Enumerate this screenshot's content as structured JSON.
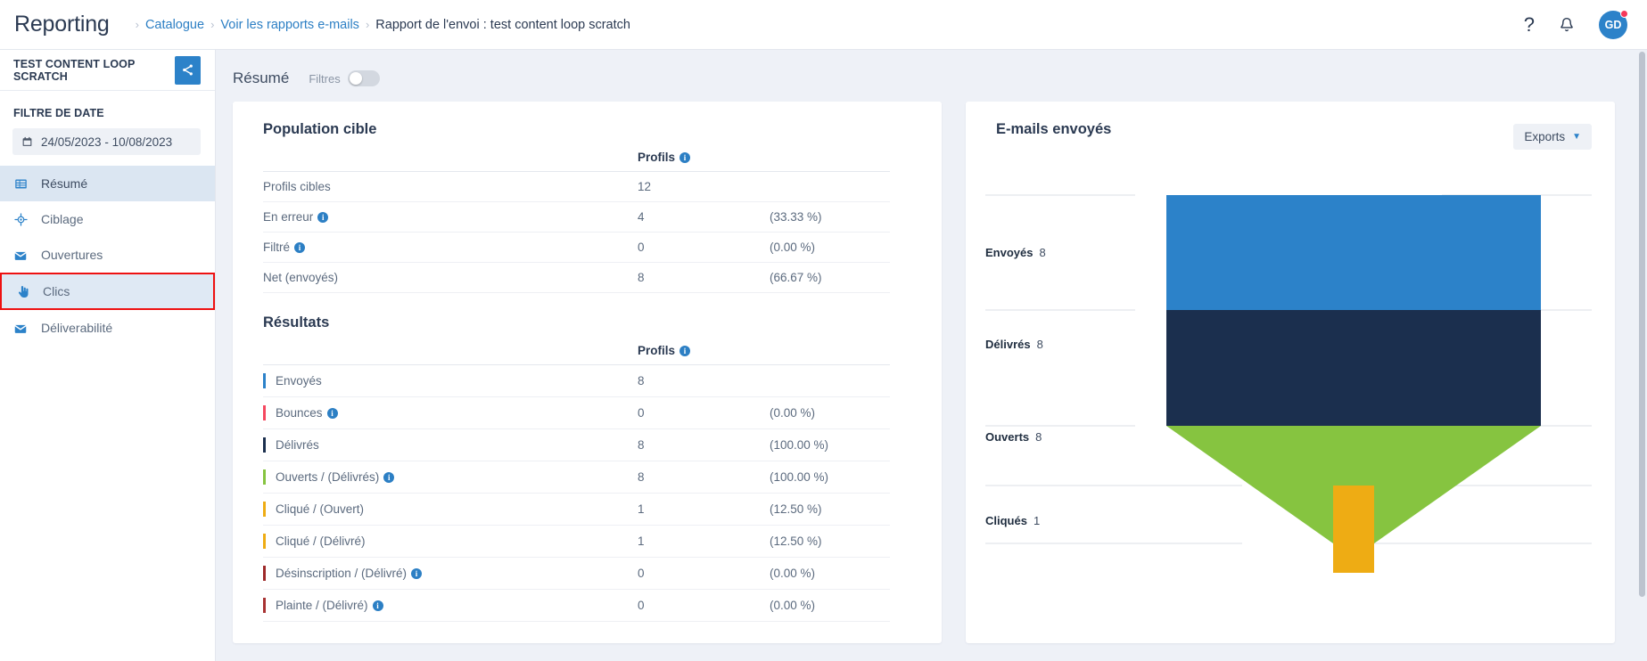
{
  "header": {
    "app_title": "Reporting",
    "breadcrumb": [
      {
        "label": "Catalogue",
        "link": true
      },
      {
        "label": "Voir les rapports e-mails",
        "link": true
      },
      {
        "label": "Rapport de l'envoi : test content loop scratch",
        "link": false
      }
    ],
    "help_icon": "question-mark-icon",
    "bell_icon": "notification-bell-icon",
    "avatar_initials": "GD"
  },
  "sidebar": {
    "campaign_name": "TEST CONTENT LOOP SCRATCH",
    "share_icon": "share-icon",
    "filter_heading": "FILTRE DE DATE",
    "date_range": "24/05/2023 - 10/08/2023",
    "calendar_icon": "calendar-icon",
    "items": [
      {
        "label": "Résumé",
        "icon": "table-grid-icon",
        "active": true,
        "highlighted": false
      },
      {
        "label": "Ciblage",
        "icon": "target-icon",
        "active": false,
        "highlighted": false
      },
      {
        "label": "Ouvertures",
        "icon": "envelope-icon",
        "active": false,
        "highlighted": false
      },
      {
        "label": "Clics",
        "icon": "pointing-hand-icon",
        "active": false,
        "highlighted": true
      },
      {
        "label": "Déliverabilité",
        "icon": "envelope-icon",
        "active": false,
        "highlighted": false
      }
    ]
  },
  "main": {
    "title": "Résumé",
    "filtres_label": "Filtres",
    "filtres_toggle_on": false
  },
  "population": {
    "title": "Population cible",
    "col_profils": "Profils",
    "rows": [
      {
        "label": "Profils cibles",
        "info": false,
        "profils": "12",
        "pct": ""
      },
      {
        "label": "En erreur",
        "info": true,
        "profils": "4",
        "pct": "(33.33 %)"
      },
      {
        "label": "Filtré",
        "info": true,
        "profils": "0",
        "pct": "(0.00 %)"
      },
      {
        "label": "Net (envoyés)",
        "info": false,
        "profils": "8",
        "pct": "(66.67 %)"
      }
    ]
  },
  "resultats": {
    "title": "Résultats",
    "col_profils": "Profils",
    "rows": [
      {
        "label": "Envoyés",
        "info": false,
        "profils": "8",
        "pct": "",
        "color": "#2c82c9"
      },
      {
        "label": "Bounces",
        "info": true,
        "profils": "0",
        "pct": "(0.00 %)",
        "color": "#f5485f"
      },
      {
        "label": "Délivrés",
        "info": false,
        "profils": "8",
        "pct": "(100.00 %)",
        "color": "#1b2f4e"
      },
      {
        "label": "Ouverts / (Délivrés)",
        "info": true,
        "profils": "8",
        "pct": "(100.00 %)",
        "color": "#86c440"
      },
      {
        "label": "Cliqué / (Ouvert)",
        "info": false,
        "profils": "1",
        "pct": "(12.50 %)",
        "color": "#eeac14"
      },
      {
        "label": "Cliqué / (Délivré)",
        "info": false,
        "profils": "1",
        "pct": "(12.50 %)",
        "color": "#eeac14"
      },
      {
        "label": "Désinscription / (Délivré)",
        "info": true,
        "profils": "0",
        "pct": "(0.00 %)",
        "color": "#9e2a2a"
      },
      {
        "label": "Plainte / (Délivré)",
        "info": true,
        "profils": "0",
        "pct": "(0.00 %)",
        "color": "#a83232"
      }
    ]
  },
  "funnel_panel": {
    "title": "E-mails envoyés",
    "exports_label": "Exports",
    "exports_caret": "chevron-down-icon"
  },
  "chart_data": {
    "type": "bar",
    "chart_kind": "funnel",
    "title": "E-mails envoyés",
    "categories": [
      "Envoyés",
      "Délivrés",
      "Ouverts",
      "Cliqués"
    ],
    "values": [
      8,
      8,
      8,
      1
    ],
    "colors": [
      "#2c82c9",
      "#1b2f4e",
      "#86c440",
      "#eeac14"
    ],
    "xlabel": "",
    "ylabel": "",
    "grid": true,
    "legend": "none",
    "max_value": 8
  }
}
